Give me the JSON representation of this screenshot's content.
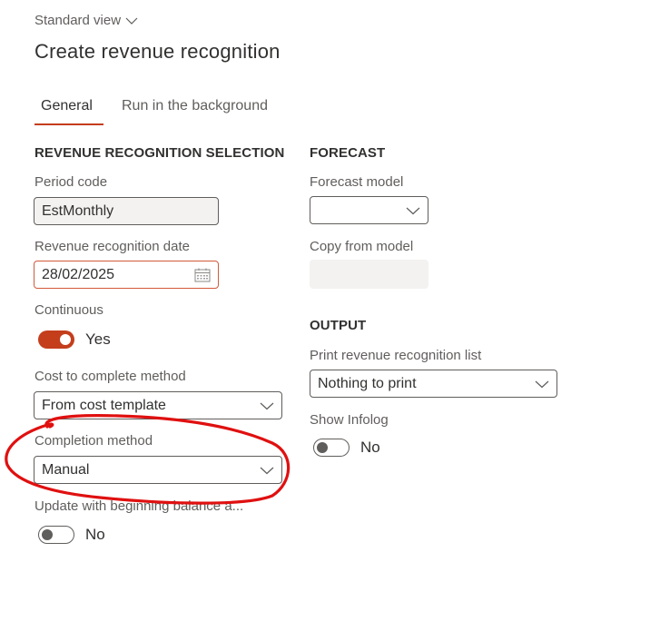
{
  "header": {
    "view_selector": "Standard view",
    "title": "Create revenue recognition"
  },
  "tabs": [
    {
      "label": "General",
      "active": true
    },
    {
      "label": "Run in the background",
      "active": false
    }
  ],
  "colors": {
    "accent": "#c43e1c",
    "error_border": "#d2593a",
    "annotation": "#e01010"
  },
  "selection": {
    "heading": "REVENUE RECOGNITION SELECTION",
    "period_code": {
      "label": "Period code",
      "value": "EstMonthly"
    },
    "recognition_date": {
      "label": "Revenue recognition date",
      "value": "28/02/2025",
      "icon": "calendar-icon"
    },
    "continuous": {
      "label": "Continuous",
      "value": "Yes",
      "on": true
    },
    "cost_to_complete": {
      "label": "Cost to complete method",
      "value": "From cost template"
    },
    "completion_method": {
      "label": "Completion method",
      "value": "Manual"
    },
    "update_beginning_balance": {
      "label": "Update with beginning balance a...",
      "value": "No",
      "on": false
    }
  },
  "forecast": {
    "heading": "FORECAST",
    "forecast_model": {
      "label": "Forecast model",
      "value": ""
    },
    "copy_from_model": {
      "label": "Copy from model",
      "value": ""
    }
  },
  "output": {
    "heading": "OUTPUT",
    "print_list": {
      "label": "Print revenue recognition list",
      "value": "Nothing to print"
    },
    "show_infolog": {
      "label": "Show Infolog",
      "value": "No",
      "on": false
    }
  }
}
